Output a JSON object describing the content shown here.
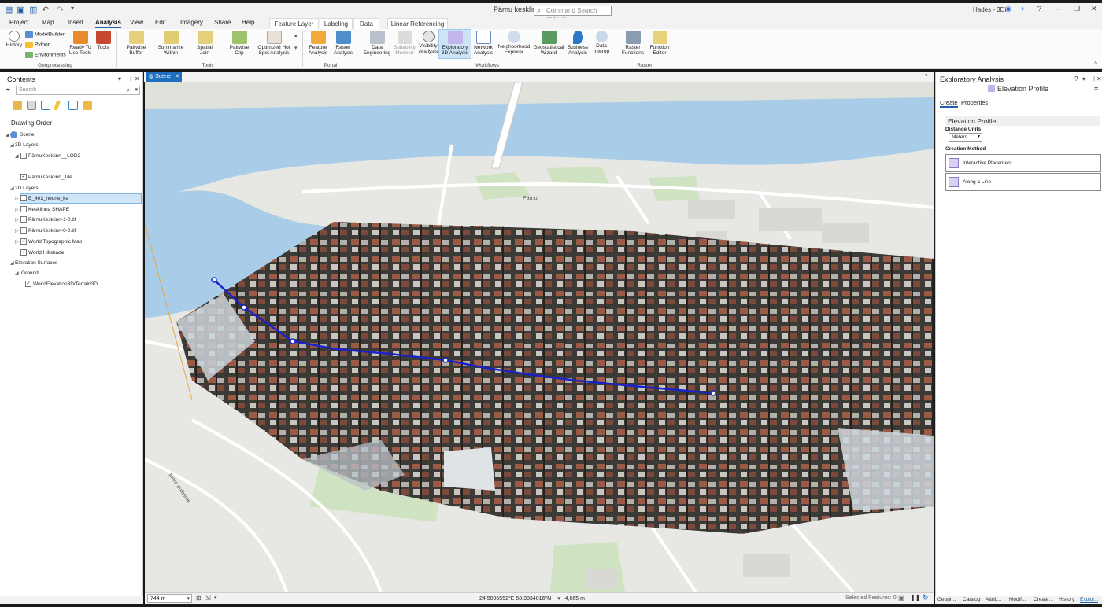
{
  "title_bar": {
    "document_title": "Pärnu kesklinn",
    "command_search_placeholder": "Command Search (Alt+Q)",
    "user": "Hades - 3Di",
    "minimize_glyph": "—",
    "maximize_glyph": "❐",
    "close_glyph": "✕",
    "help_glyph": "?"
  },
  "ribbon_tabs": [
    "Project",
    "Map",
    "Insert",
    "Analysis",
    "View",
    "Edit",
    "Imagery",
    "Share",
    "Help"
  ],
  "active_tab": "Analysis",
  "contextual_tabs": [
    "Feature Layer",
    "Labeling",
    "Data",
    "Linear Referencing"
  ],
  "ribbon": {
    "geoprocessing": {
      "label": "Geoprocessing",
      "history": "History",
      "modelbuilder": "ModelBuilder",
      "python": "Python",
      "environments": "Environments",
      "ready_to_use_1": "Ready To",
      "ready_to_use_2": "Use Tools",
      "tools": "Tools"
    },
    "tools_group": {
      "label": "Tools",
      "items": [
        [
          "Pairwise",
          "Buffer"
        ],
        [
          "Summarize",
          "Within"
        ],
        [
          "Spatial",
          "Join"
        ],
        [
          "Pairwise",
          "Clip"
        ],
        [
          "Optimized Hot",
          "Spot Analysis"
        ]
      ]
    },
    "portal": {
      "label": "Portal",
      "items": [
        [
          "Feature",
          "Analysis"
        ],
        [
          "Raster",
          "Analysis"
        ]
      ]
    },
    "workflows": {
      "label": "Workflows",
      "items": [
        [
          "Data",
          "Engineering"
        ],
        [
          "Suitability",
          "Modeler"
        ],
        [
          "Visibility",
          "Analysis"
        ],
        [
          "Exploratory",
          "3D Analysis"
        ],
        [
          "Network",
          "Analysis"
        ],
        [
          "Neighborhood",
          "Explorer"
        ],
        [
          "Geostatistical",
          "Wizard"
        ],
        [
          "Business",
          "Analysis"
        ],
        [
          "Data",
          "Interop"
        ]
      ]
    },
    "raster": {
      "label": "Raster",
      "items": [
        [
          "Raster",
          "Functions"
        ],
        [
          "Function",
          "Editor"
        ]
      ]
    }
  },
  "contents": {
    "title": "Contents",
    "search_placeholder": "Search",
    "drawing_order": "Drawing Order",
    "tree": {
      "scene": "Scene",
      "layers3d": "3D Layers",
      "lod2": "PärnuKesklinn__LOD2",
      "tile": "PärnuKesklinn_Tile",
      "layers2d": "2D Layers",
      "hoone": "E_401_hoone_ka",
      "shape": "Kesklinna SHAPE",
      "tif1": "PärnuKesklinn-1-0.tif",
      "tif0": "PärnuKesklinn-0-0.tif",
      "topo": "World Topographic Map",
      "hillshade": "World Hillshade",
      "elevation": "Elevation Surfaces",
      "ground": "Ground",
      "terrain": "WorldElevation3D/Terrain3D"
    }
  },
  "scene_view": {
    "tab_label": "Scene",
    "map_labels": {
      "parnu": "Pärnu",
      "mere": "Mere puiestee"
    }
  },
  "status_bar": {
    "scale": "744 m",
    "coordinates": "24,5005552°E 58,3834016°N",
    "elevation": "4,665 m",
    "selected_features": "Selected Features: 0"
  },
  "exploratory_pane": {
    "title": "Exploratory Analysis",
    "subtitle": "Elevation Profile",
    "tabs": [
      "Create",
      "Properties"
    ],
    "section": "Elevation Profile",
    "distance_units_label": "Distance Units",
    "distance_units_value": "Meters",
    "creation_method_label": "Creation Method",
    "methods": [
      "Interactive Placement",
      "Along a Line"
    ]
  },
  "bottom_tabs": [
    "Geopr...",
    "Catalog",
    "Attrib...",
    "Modif...",
    "Create...",
    "History",
    "Explor..."
  ],
  "colors": {
    "accent": "#1f5fa8",
    "profile_line": "#1a22c8",
    "water": "#a9cde8",
    "park": "#cfe3c2"
  }
}
